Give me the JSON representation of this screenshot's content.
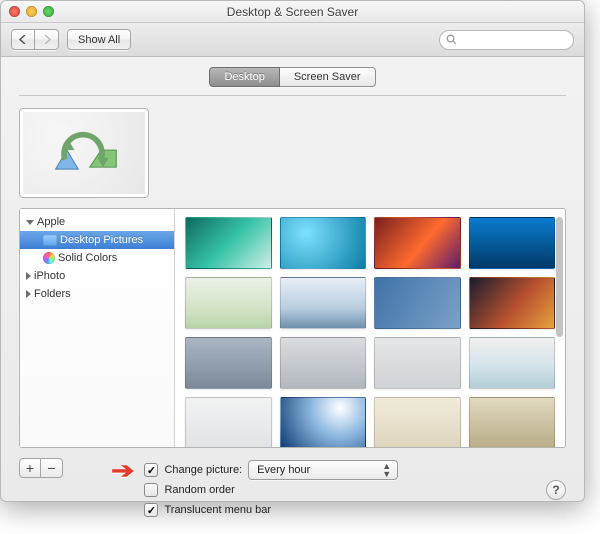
{
  "window_title": "Desktop & Screen Saver",
  "toolbar": {
    "show_all": "Show All"
  },
  "search": {
    "placeholder": ""
  },
  "tabs": {
    "desktop": "Desktop",
    "screen_saver": "Screen Saver"
  },
  "tree": {
    "apple": "Apple",
    "desktop_pictures": "Desktop Pictures",
    "solid_colors": "Solid Colors",
    "iphoto": "iPhoto",
    "folders": "Folders"
  },
  "buttons": {
    "plus": "+",
    "minus": "−"
  },
  "options": {
    "change_picture_label": "Change picture:",
    "change_picture_value": "Every hour",
    "random_order": "Random order",
    "translucent": "Translucent menu bar"
  },
  "help": "?"
}
